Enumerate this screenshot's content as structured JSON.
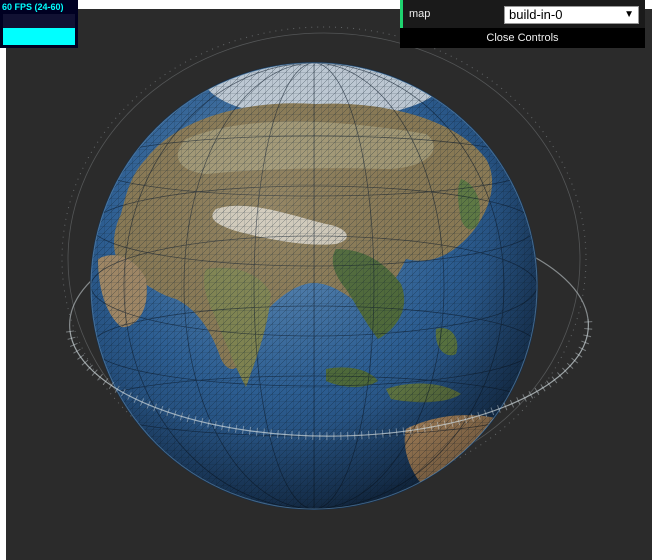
{
  "stats": {
    "fps_text": "60 FPS (24-60)",
    "fps": 60,
    "fps_min": 24,
    "fps_max": 60,
    "color": "#00ffff"
  },
  "controls": {
    "map_label": "map",
    "map_value": "build-in-0",
    "dropdown_icon": "chevron-down-icon",
    "close_label": "Close Controls"
  },
  "scene": {
    "background": "#2b2b2b",
    "ocean_color": "#2d5f94",
    "land_color": "#8a7a55",
    "grid_color": "#0f1e2e",
    "ring_color": "#cfd8dc"
  }
}
